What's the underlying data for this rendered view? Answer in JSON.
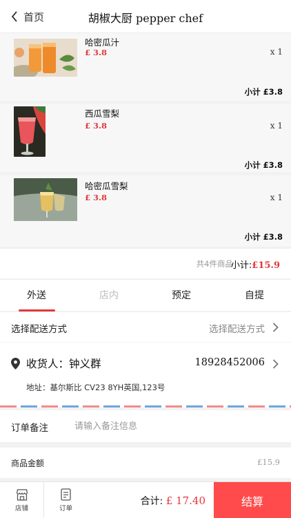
{
  "nav": {
    "back_label": "首页",
    "title": "胡椒大厨 pepper chef"
  },
  "items": [
    {
      "name": "哈密瓜汁",
      "price": "£ 3.8",
      "qty": "x 1",
      "subtotal": "小计 £3.8"
    },
    {
      "name": "西瓜雪梨",
      "price": "£ 3.8",
      "qty": "x 1",
      "subtotal": "小计 £3.8"
    },
    {
      "name": "哈密瓜雪梨",
      "price": "£ 3.8",
      "qty": "x 1",
      "subtotal": "小计 £3.8"
    }
  ],
  "summary": {
    "count_text": "共4件商品",
    "subtotal_label": "小计:",
    "subtotal_value": "£15.9"
  },
  "tabs": [
    {
      "label": "外送",
      "active": true
    },
    {
      "label": "店内",
      "disabled": true
    },
    {
      "label": "预定"
    },
    {
      "label": "自提"
    }
  ],
  "delivery": {
    "label": "选择配送方式",
    "value": "选择配送方式"
  },
  "address": {
    "receiver": "收货人：钟义群",
    "phone": "18928452006",
    "address": "地址：基尔斯比 CV23 8YH英国,123号"
  },
  "note": {
    "label": "订单备注",
    "placeholder": "请输入备注信息"
  },
  "goods": {
    "label": "商品金额",
    "value": "£15.9"
  },
  "bottom": {
    "store_label": "店铺",
    "order_label": "订单",
    "total_label": "合计:",
    "total_value": "£ 17.40",
    "checkout_label": "结算"
  },
  "colors": {
    "accent": "#e2373a",
    "checkout_bg": "#ff4b4b",
    "stripe_red": "#f28b8c",
    "stripe_blue": "#6ea6e0"
  }
}
